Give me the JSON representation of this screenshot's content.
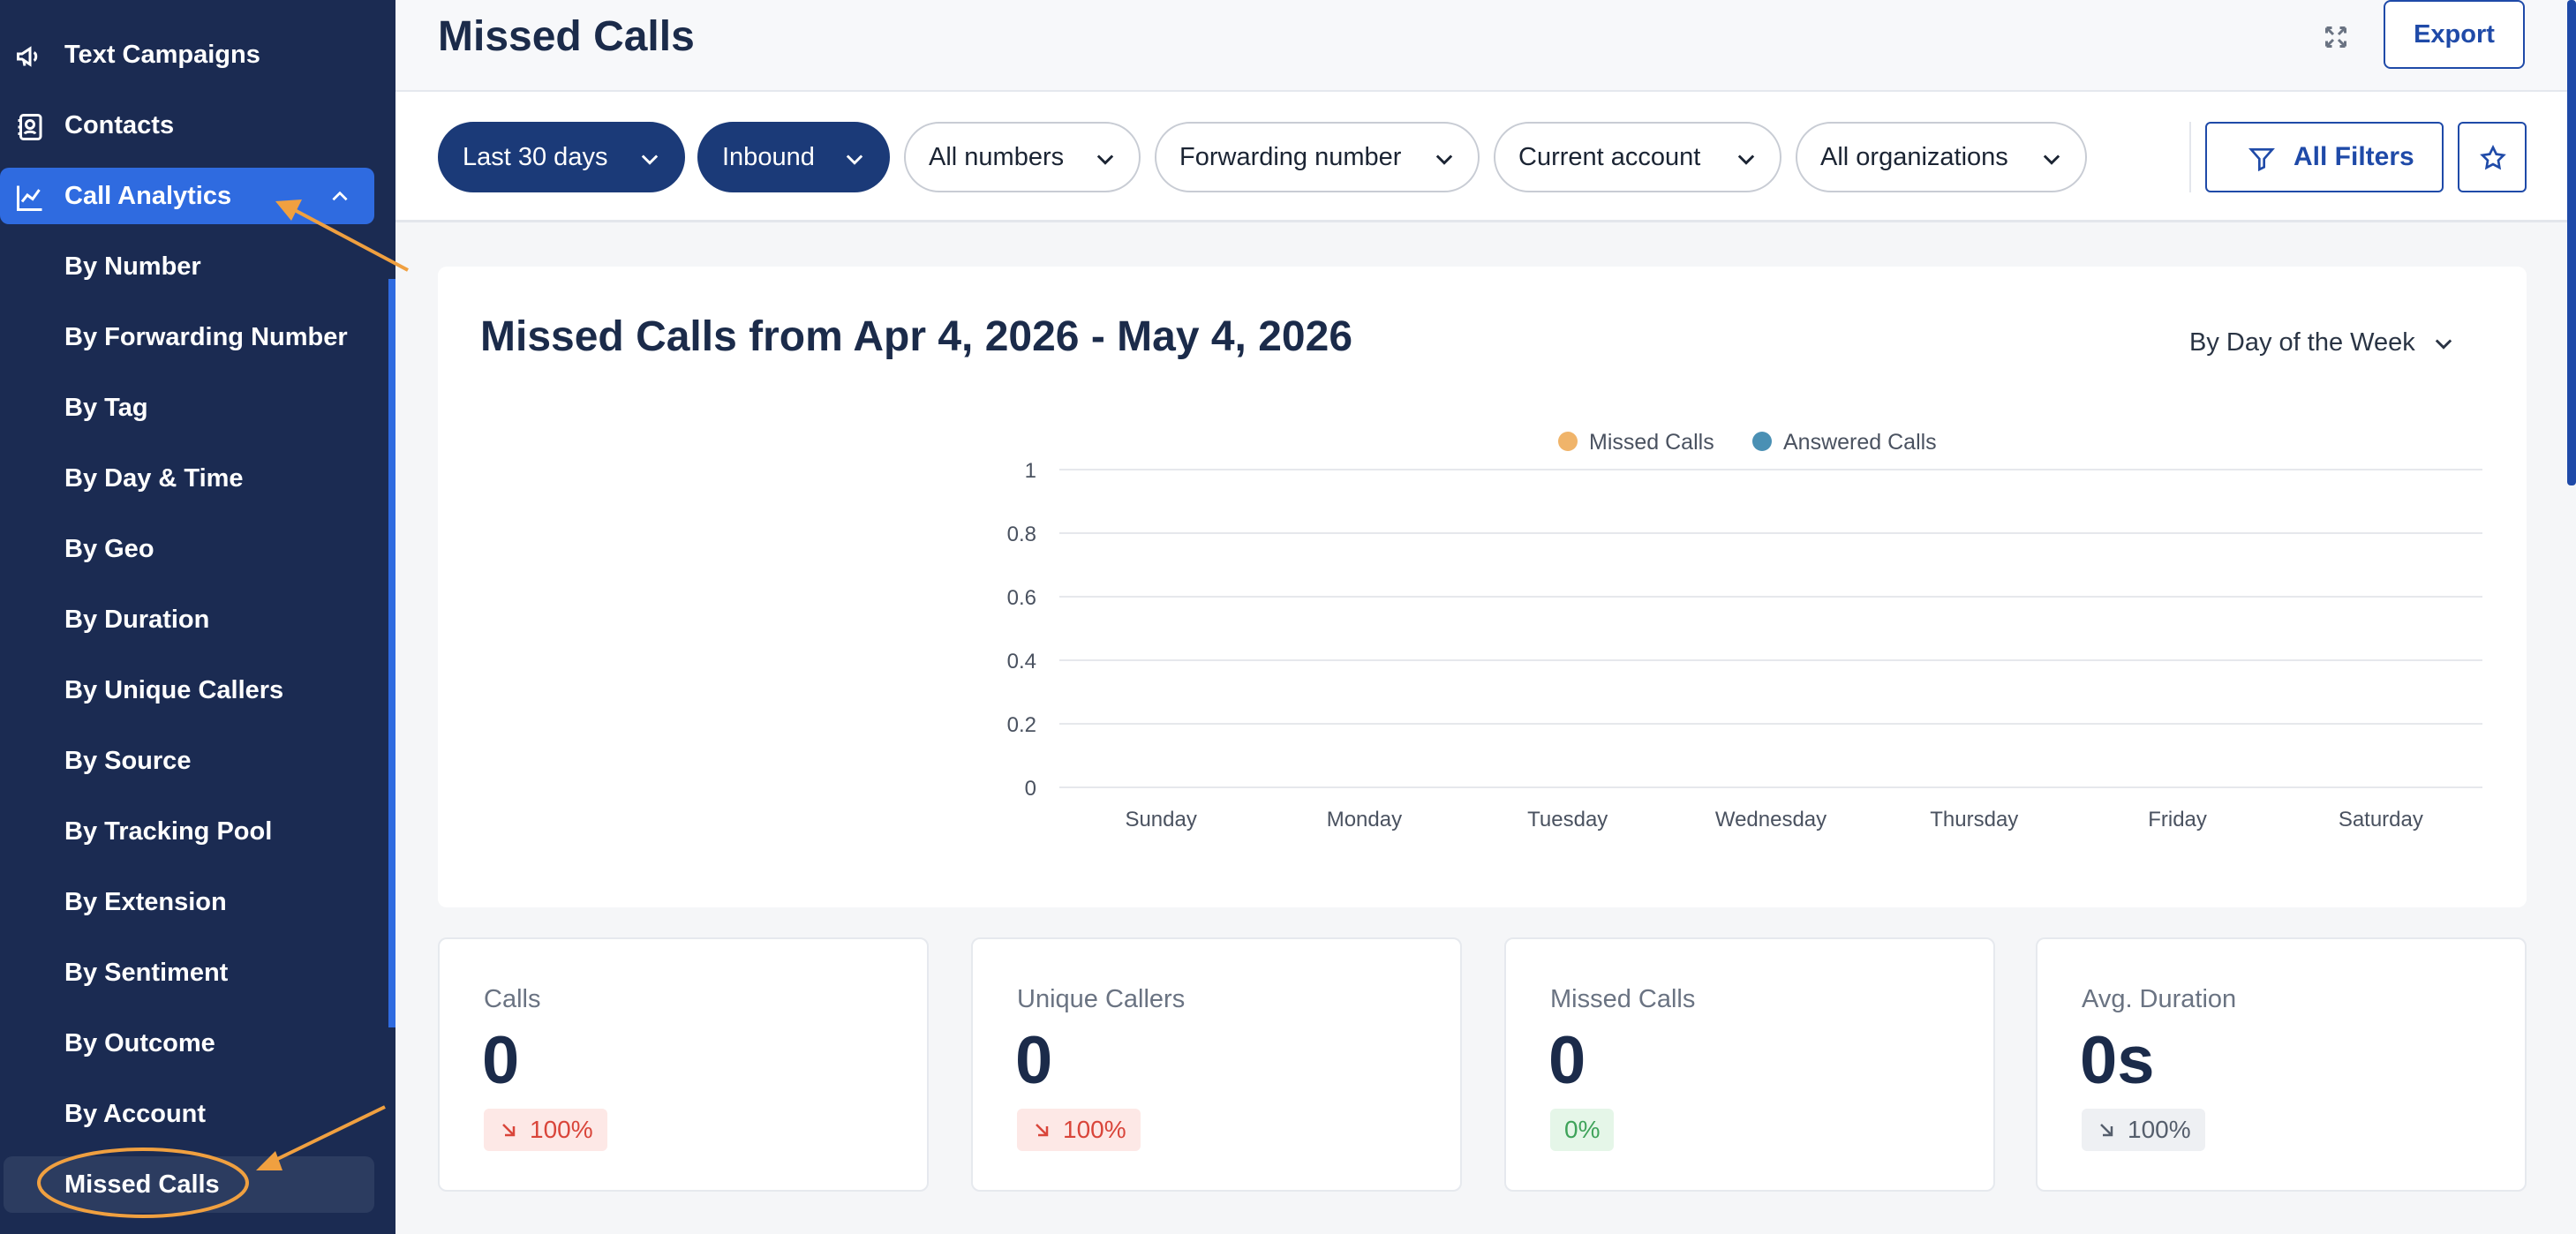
{
  "sidebar": {
    "top_items": [
      {
        "label": "Text Campaigns",
        "icon": "megaphone-icon"
      },
      {
        "label": "Contacts",
        "icon": "contacts-icon"
      }
    ],
    "active_section": {
      "label": "Call Analytics",
      "icon": "line-chart-icon"
    },
    "sub_items": [
      {
        "label": "By Number"
      },
      {
        "label": "By Forwarding Number"
      },
      {
        "label": "By Tag"
      },
      {
        "label": "By Day & Time"
      },
      {
        "label": "By Geo"
      },
      {
        "label": "By Duration"
      },
      {
        "label": "By Unique Callers"
      },
      {
        "label": "By Source"
      },
      {
        "label": "By Tracking Pool"
      },
      {
        "label": "By Extension"
      },
      {
        "label": "By Sentiment"
      },
      {
        "label": "By Outcome"
      },
      {
        "label": "By Account"
      },
      {
        "label": "Missed Calls"
      }
    ]
  },
  "header": {
    "title": "Missed Calls",
    "export_label": "Export"
  },
  "filters": {
    "pills": [
      "Last 30 days",
      "Inbound",
      "All numbers",
      "Forwarding number",
      "Current account",
      "All organizations"
    ],
    "all_filters_label": "All Filters"
  },
  "chart": {
    "title": "Missed Calls from Apr 4, 2026 - May 4, 2026",
    "group_by": "By Day of the Week"
  },
  "chart_data": {
    "type": "line",
    "categories": [
      "Sunday",
      "Monday",
      "Tuesday",
      "Wednesday",
      "Thursday",
      "Friday",
      "Saturday"
    ],
    "series": [
      {
        "name": "Missed Calls",
        "color": "#f0b46a",
        "values": [
          0,
          0,
          0,
          0,
          0,
          0,
          0
        ]
      },
      {
        "name": "Answered Calls",
        "color": "#4a90b4",
        "values": [
          0,
          0,
          0,
          0,
          0,
          0,
          0
        ]
      }
    ],
    "yticks": [
      "1",
      "0.8",
      "0.6",
      "0.4",
      "0.2",
      "0"
    ],
    "ylim": [
      0,
      1
    ],
    "legend": "top-center",
    "grid": true
  },
  "stats": [
    {
      "label": "Calls",
      "value": "0",
      "change": "100%",
      "trend": "down",
      "tone": "red"
    },
    {
      "label": "Unique Callers",
      "value": "0",
      "change": "100%",
      "trend": "down",
      "tone": "red"
    },
    {
      "label": "Missed Calls",
      "value": "0",
      "change": "0%",
      "trend": "none",
      "tone": "green"
    },
    {
      "label": "Avg. Duration",
      "value": "0s",
      "change": "100%",
      "trend": "down",
      "tone": "grey"
    }
  ],
  "colors": {
    "sidebar_bg": "#1b2b52",
    "accent": "#2f6be0",
    "primary_dark": "#1b3a78",
    "annotation": "#f0a040"
  }
}
